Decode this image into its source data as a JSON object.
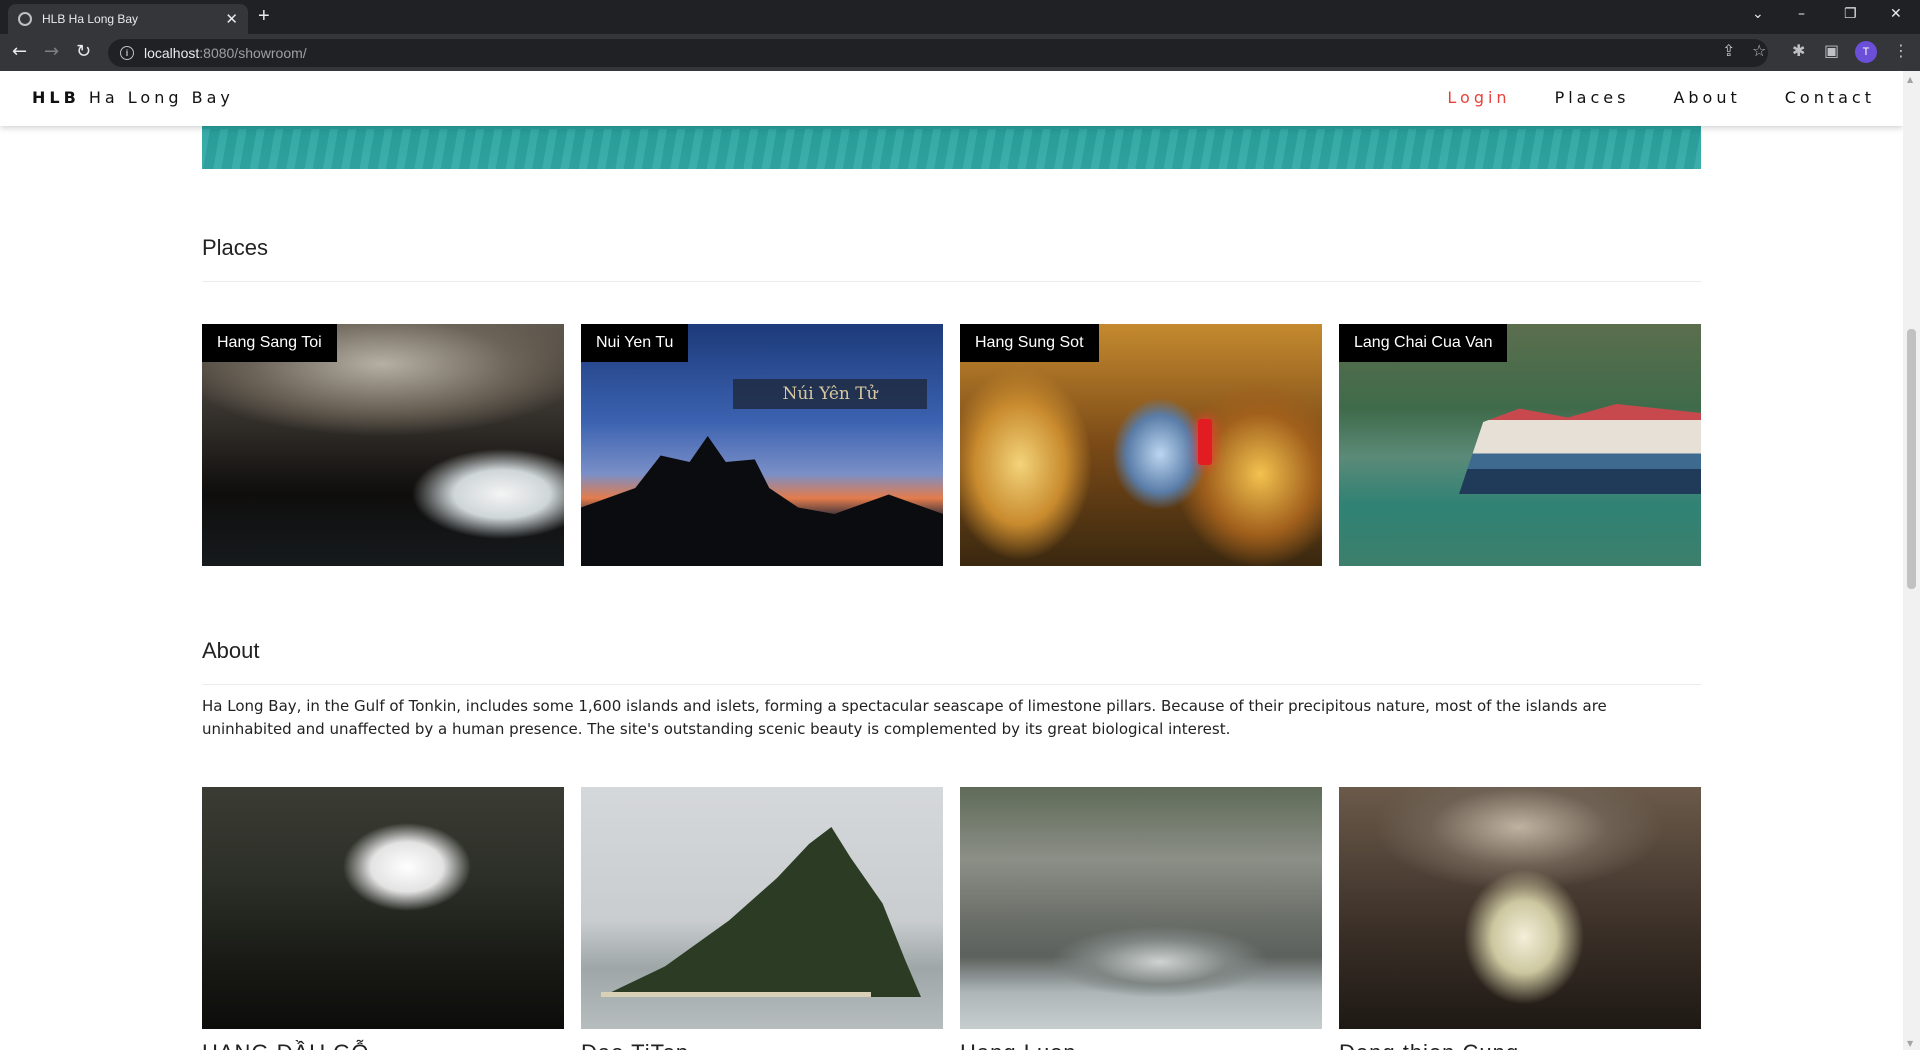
{
  "browser": {
    "tab_title": "HLB Ha Long Bay",
    "tab_close": "✕",
    "new_tab": "+",
    "url_host": "localhost",
    "url_path": ":8080/showroom/",
    "avatar_letter": "T",
    "controls": {
      "tab_search": "⌄",
      "minimize": "–",
      "restore": "❐",
      "close": "✕"
    }
  },
  "site": {
    "brand_bold": "HLB",
    "brand_rest": "Ha Long Bay",
    "nav": {
      "login": "Login",
      "places": "Places",
      "about": "About",
      "contact": "Contact"
    }
  },
  "places": {
    "title": "Places",
    "cards": [
      {
        "label": "Hang Sang Toi"
      },
      {
        "label": "Nui Yen Tu",
        "sign_text": "Núi Yên Tử"
      },
      {
        "label": "Hang Sung Sot"
      },
      {
        "label": "Lang Chai Cua Van"
      }
    ]
  },
  "about": {
    "title": "About",
    "text": "Ha Long Bay, in the Gulf of Tonkin, includes some 1,600 islands and islets, forming a spectacular seascape of limestone pillars. Because of their precipitous nature, most of the islands are uninhabited and unaffected by a human presence. The site's outstanding scenic beauty is complemented by its great biological interest.",
    "gallery": [
      {
        "caption": "HANG DẦU GỖ"
      },
      {
        "caption": "Dao TiTop"
      },
      {
        "caption": "Hang Luon"
      },
      {
        "caption": "Dong thien Cung"
      }
    ]
  },
  "colors": {
    "accent": "#e8413b",
    "chrome_dark": "#202124",
    "chrome_mid": "#35363a"
  }
}
